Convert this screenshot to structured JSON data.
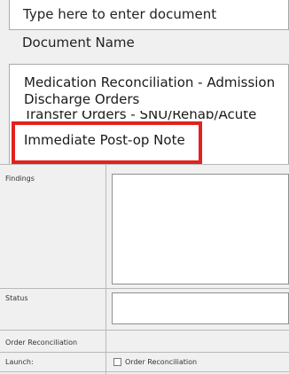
{
  "document_picker": {
    "search_placeholder": "Type here to enter document",
    "document_name_label": "Document Name",
    "items": [
      "Medication Reconciliation - Admission",
      "Discharge Orders",
      "Transfer Orders - SNU/Rehab/Acute",
      "Immediate Post-op Note"
    ],
    "highlighted_item_index": 3
  },
  "form": {
    "findings_label": "Findings",
    "status_label": "Status",
    "order_reconciliation_label": "Order Reconciliation",
    "launch_label": "Launch:",
    "launch_checkbox_label": "Order Reconciliation",
    "launch_checkbox_checked": false
  },
  "colors": {
    "highlight": "#e2221f"
  }
}
